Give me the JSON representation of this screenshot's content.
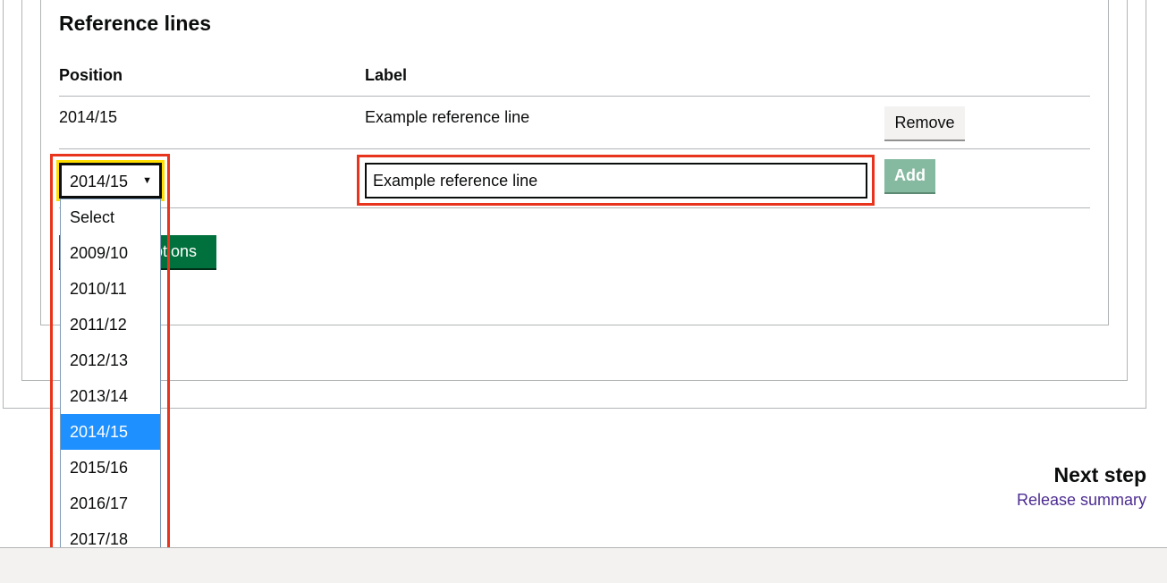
{
  "section": {
    "title": "Reference lines"
  },
  "table": {
    "headers": {
      "position": "Position",
      "label": "Label"
    },
    "rows": [
      {
        "position": "2014/15",
        "label": "Example reference line",
        "action": "Remove"
      }
    ]
  },
  "new_line": {
    "position_value": "2014/15",
    "label_value": "Example reference line",
    "add_label": "Add"
  },
  "save_button": {
    "visible_label": "ptions"
  },
  "dropdown": {
    "options": [
      "Select",
      "2009/10",
      "2010/11",
      "2011/12",
      "2012/13",
      "2013/14",
      "2014/15",
      "2015/16",
      "2016/17",
      "2017/18"
    ],
    "selected": "2014/15"
  },
  "next_step": {
    "title": "Next step",
    "link": "Release summary"
  },
  "colors": {
    "primary_green": "#00703c",
    "disabled_green": "#85b9a0",
    "highlight_red": "#e8341c",
    "link_purple": "#4c2c92",
    "selected_blue": "#1e90ff"
  },
  "icons": {
    "select_arrow": "caret-down-icon"
  }
}
